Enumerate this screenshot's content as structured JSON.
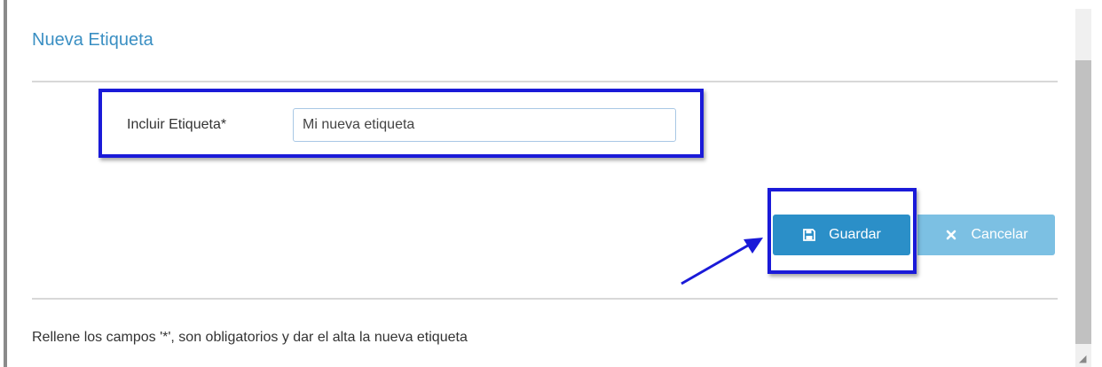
{
  "modal": {
    "title": "Nueva Etiqueta"
  },
  "form": {
    "label": "Incluir Etiqueta*",
    "input_value": "Mi nueva etiqueta"
  },
  "buttons": {
    "save_label": "Guardar",
    "save_icon": "save-icon",
    "cancel_label": "Cancelar",
    "cancel_icon": "close-icon"
  },
  "footer": {
    "help_text": "Rellene los campos '*', son obligatorios y dar el alta la nueva etiqueta"
  },
  "colors": {
    "title": "#3a8fc3",
    "save_button": "#2b8fc8",
    "cancel_button": "#7cc0e3",
    "highlight": "#1a1ad8"
  }
}
